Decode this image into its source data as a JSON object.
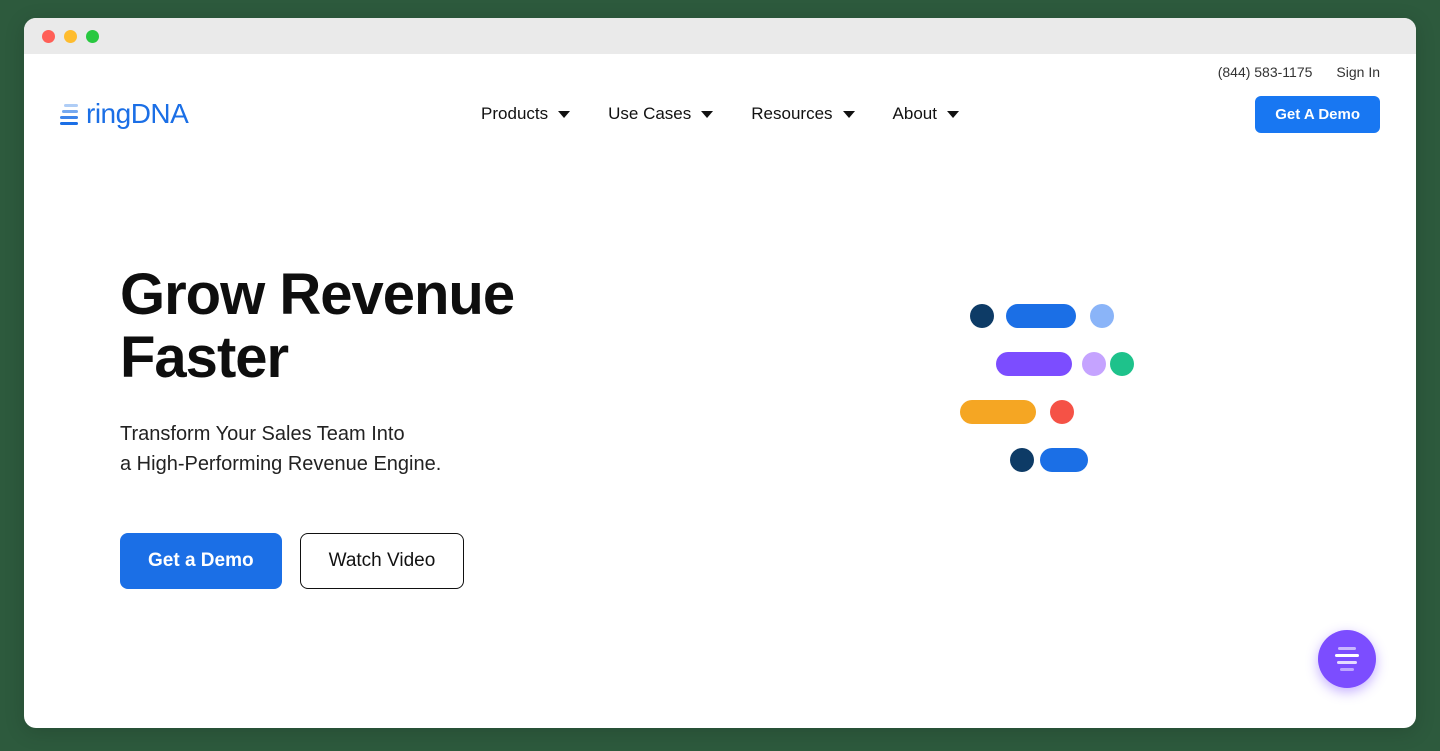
{
  "brand": {
    "name": "ringDNA"
  },
  "topbar": {
    "phone": "(844) 583-1175",
    "signin": "Sign In"
  },
  "nav": {
    "items": [
      {
        "label": "Products"
      },
      {
        "label": "Use Cases"
      },
      {
        "label": "Resources"
      },
      {
        "label": "About"
      }
    ],
    "cta": "Get A Demo"
  },
  "hero": {
    "headline_l1": "Grow Revenue",
    "headline_l2": "Faster",
    "sub_l1": "Transform Your Sales Team Into",
    "sub_l2": "a High-Performing Revenue Engine.",
    "primary_btn": "Get a Demo",
    "secondary_btn": "Watch Video"
  }
}
